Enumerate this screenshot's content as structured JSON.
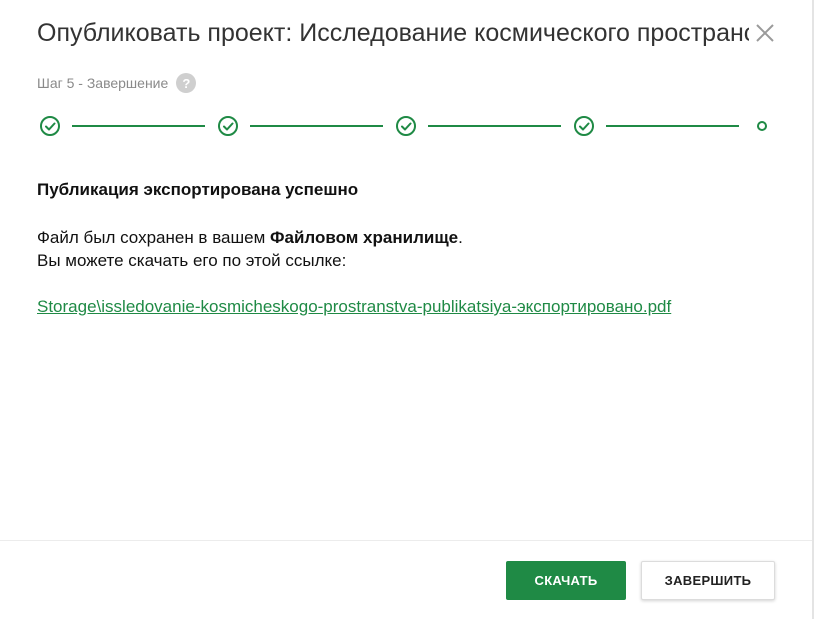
{
  "dialog": {
    "title": "Опубликовать проект: Исследование космического пространства",
    "close_icon": "close-icon"
  },
  "step": {
    "label": "Шаг 5 - Завершение",
    "help_glyph": "?",
    "current": 5,
    "total": 5,
    "completed": 4
  },
  "content": {
    "heading": "Публикация экспортирована успешно",
    "line1_prefix": "Файл был сохранен в вашем ",
    "line1_bold": "Файловом хранилище",
    "line1_suffix": ".",
    "line2": "Вы можете скачать его по этой ссылке:",
    "link_text": "Storage\\issledovanie-kosmicheskogo-prostranstva-publikatsiya-экспортировано.pdf"
  },
  "footer": {
    "download_label": "СКАЧАТЬ",
    "finish_label": "ЗАВЕРШИТЬ"
  },
  "colors": {
    "accent": "#1f8a45",
    "help_bg": "#cfcfcf"
  }
}
